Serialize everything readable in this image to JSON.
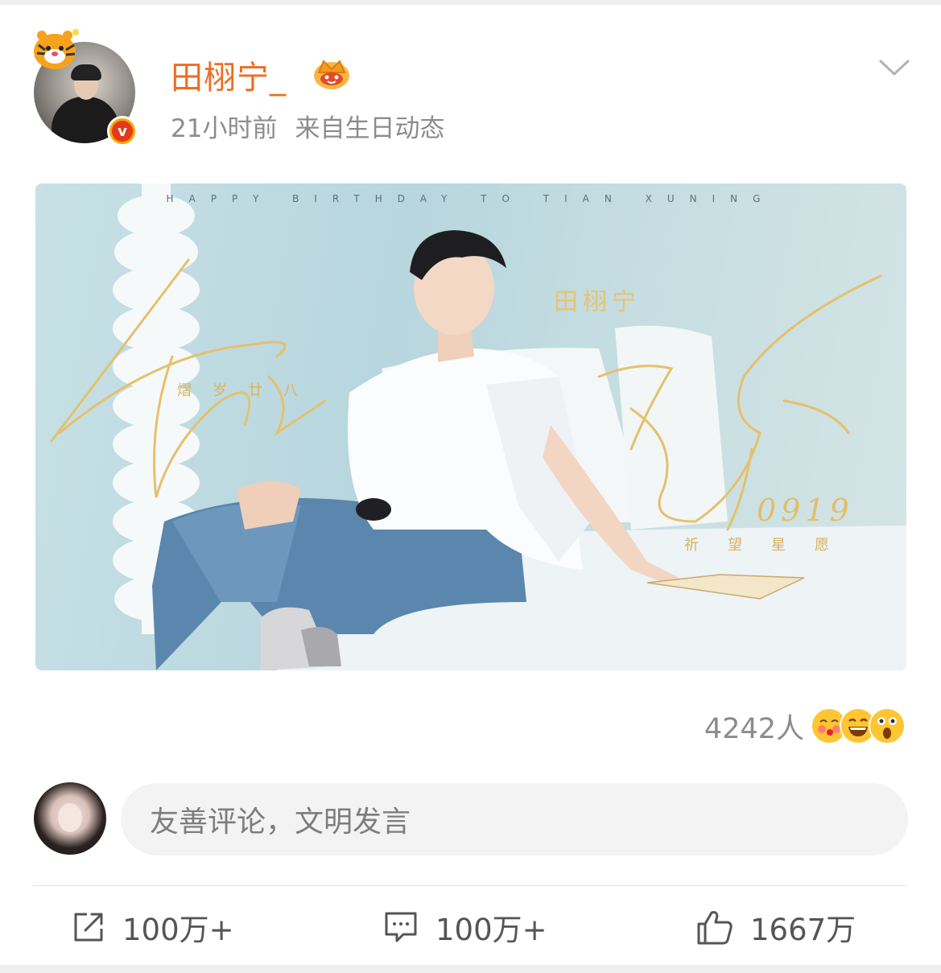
{
  "post": {
    "username": "田栩宁_",
    "time": "21小时前",
    "source": "来自生日动态"
  },
  "poster": {
    "top_line": "HAPPY BIRTHDAY TO TIAN XUNING",
    "name": "田栩宁",
    "sub_left": "熠岁廿八",
    "date": "0919",
    "sub_right": "祈望星愿"
  },
  "reactions": {
    "count": "4242人"
  },
  "comment": {
    "placeholder": "友善评论，文明发言"
  },
  "actions": {
    "share": "100万+",
    "comments": "100万+",
    "likes": "1667万"
  },
  "colors": {
    "username": "#f06b21",
    "meta": "#8c8c8c",
    "gold": "#e2be6a"
  }
}
